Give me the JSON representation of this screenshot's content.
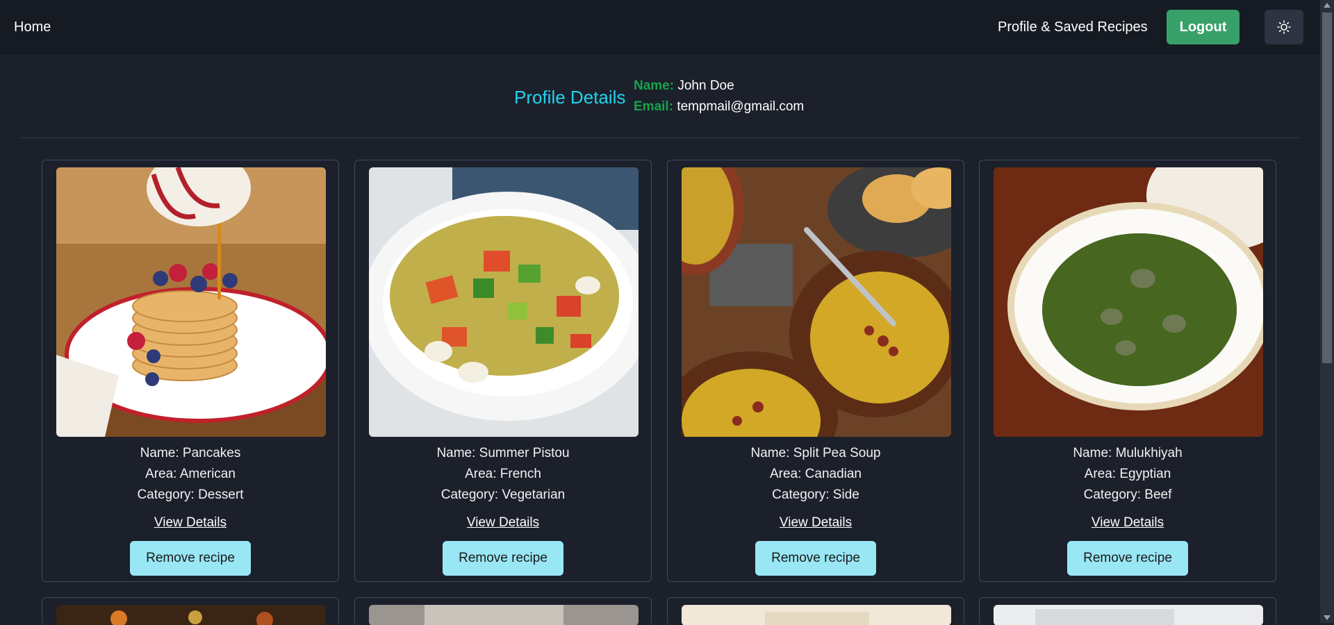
{
  "nav": {
    "home": "Home",
    "profile": "Profile & Saved Recipes",
    "logout": "Logout",
    "theme_icon": "sun-icon"
  },
  "profile": {
    "title": "Profile Details",
    "name_label": "Name:",
    "name": "John Doe",
    "email_label": "Email:",
    "email": "tempmail@gmail.com"
  },
  "recipes": [
    {
      "name": "Name: Pancakes",
      "area": "Area: American",
      "category": "Category: Dessert",
      "view": "View Details",
      "remove": "Remove recipe"
    },
    {
      "name": "Name: Summer Pistou",
      "area": "Area: French",
      "category": "Category: Vegetarian",
      "view": "View Details",
      "remove": "Remove recipe"
    },
    {
      "name": "Name: Split Pea Soup",
      "area": "Area: Canadian",
      "category": "Category: Side",
      "view": "View Details",
      "remove": "Remove recipe"
    },
    {
      "name": "Name: Mulukhiyah",
      "area": "Area: Egyptian",
      "category": "Category: Beef",
      "view": "View Details",
      "remove": "Remove recipe"
    }
  ],
  "colors": {
    "accent": "#22d3ee",
    "label_green": "#16a34a",
    "logout_bg": "#38a169",
    "remove_bg": "#99e6f5",
    "background": "#1b202b"
  }
}
